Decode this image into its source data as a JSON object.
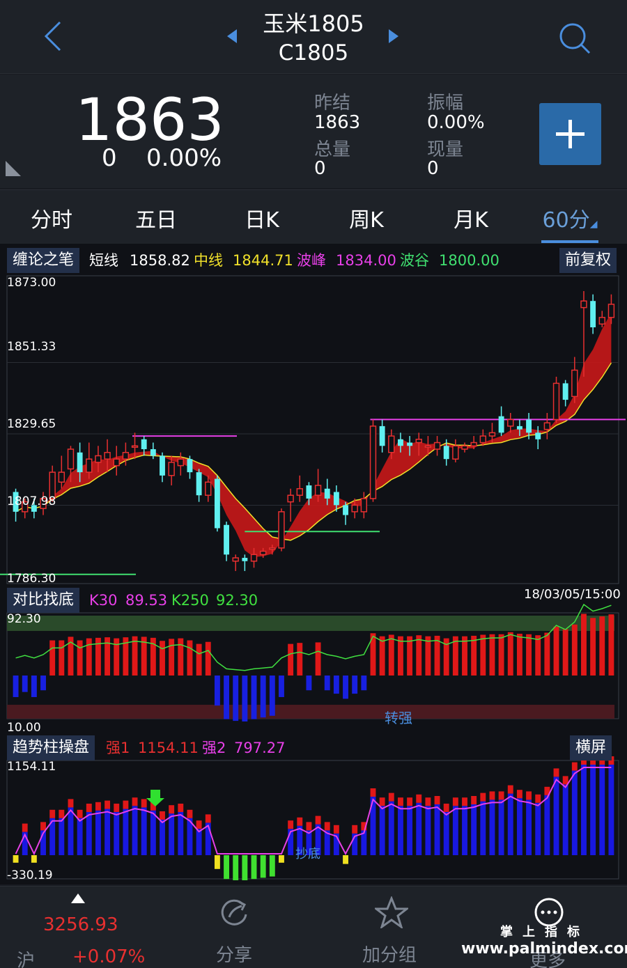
{
  "header": {
    "title": "玉米1805",
    "code": "C1805",
    "colors": {
      "accent": "#4a8ede"
    }
  },
  "quote": {
    "price": "1863",
    "change": "0",
    "change_pct": "0.00%",
    "stats": [
      {
        "label": "昨结",
        "value": "1863"
      },
      {
        "label": "振幅",
        "value": "0.00%"
      },
      {
        "label": "总量",
        "value": "0"
      },
      {
        "label": "现量",
        "value": "0"
      }
    ],
    "add_button": "+"
  },
  "tabs": {
    "items": [
      "分时",
      "五日",
      "日K",
      "周K",
      "月K",
      "60分"
    ],
    "active": "60分"
  },
  "main_chart": {
    "panel_label": "缠论之笔",
    "short_label": "短线",
    "short_value": "1858.82",
    "mid_label": "中线",
    "mid_value": "1844.71",
    "peak_label": "波峰",
    "peak_value": "1834.00",
    "trough_label": "波谷",
    "trough_value": "1800.00",
    "adjust_button": "前复权",
    "y_ticks": [
      "1873.00",
      "1851.33",
      "1829.65",
      "1807.98",
      "1786.30"
    ],
    "timestamp": "18/03/05/15:00"
  },
  "compare_panel": {
    "label": "对比找底",
    "k30_label": "K30",
    "k30_value": "89.53",
    "k250_label": "K250",
    "k250_value": "92.30",
    "y_top": "92.30",
    "y_bottom": "10.00",
    "signal": "转强"
  },
  "trend_panel": {
    "label": "趋势柱操盘",
    "s1_label": "强1",
    "s1_value": "1154.11",
    "s2_label": "强2",
    "s2_value": "797.27",
    "landscape_button": "横屏",
    "y_top": "1154.11",
    "y_bottom": "-330.19",
    "signal": "抄底"
  },
  "bottom_bar": {
    "index_value": "3256.93",
    "index_name": "沪",
    "index_change": "+0.07%",
    "share": "分享",
    "add_group": "加分组",
    "more": "更多"
  },
  "watermark": {
    "cn": "掌上指标",
    "url": "www.palmindex.com"
  },
  "chart_data": {
    "type": "candlestick",
    "y_range": [
      1786.3,
      1873.0
    ],
    "candles": [
      [
        1812,
        1806,
        1813,
        1803
      ],
      [
        1806,
        1809,
        1810,
        1804
      ],
      [
        1808,
        1806,
        1810,
        1804
      ],
      [
        1807,
        1810,
        1812,
        1805
      ],
      [
        1810,
        1818,
        1820,
        1809
      ],
      [
        1815,
        1818,
        1823,
        1813
      ],
      [
        1819,
        1825,
        1826,
        1815
      ],
      [
        1824,
        1818,
        1827,
        1815
      ],
      [
        1818,
        1822,
        1827,
        1816
      ],
      [
        1821,
        1823,
        1826,
        1818
      ],
      [
        1822,
        1824,
        1828,
        1818
      ],
      [
        1820,
        1822,
        1826,
        1817
      ],
      [
        1822,
        1824,
        1827,
        1820
      ],
      [
        1826,
        1826,
        1830,
        1822
      ],
      [
        1828,
        1825,
        1829,
        1823
      ],
      [
        1825,
        1823,
        1827,
        1822
      ],
      [
        1823,
        1817,
        1824,
        1815
      ],
      [
        1817,
        1821,
        1823,
        1814
      ],
      [
        1820,
        1822,
        1824,
        1817
      ],
      [
        1822,
        1818,
        1823,
        1816
      ],
      [
        1818,
        1811,
        1819,
        1809
      ],
      [
        1811,
        1815,
        1817,
        1809
      ],
      [
        1816,
        1801,
        1817,
        1800
      ],
      [
        1802,
        1793,
        1803,
        1791
      ],
      [
        1791,
        1792,
        1793,
        1788
      ],
      [
        1792,
        1791,
        1793,
        1788
      ],
      [
        1791,
        1793,
        1795,
        1789
      ],
      [
        1793,
        1794,
        1795,
        1792
      ],
      [
        1795,
        1795,
        1796,
        1793
      ],
      [
        1795,
        1806,
        1807,
        1794
      ],
      [
        1809,
        1811,
        1813,
        1803
      ],
      [
        1811,
        1813,
        1817,
        1809
      ],
      [
        1814,
        1810,
        1815,
        1808
      ],
      [
        1811,
        1814,
        1819,
        1809
      ],
      [
        1813,
        1810,
        1816,
        1808
      ],
      [
        1812,
        1808,
        1814,
        1806
      ],
      [
        1808,
        1805,
        1809,
        1802
      ],
      [
        1806,
        1808,
        1810,
        1804
      ],
      [
        1806,
        1810,
        1812,
        1804
      ],
      [
        1810,
        1832,
        1834,
        1809
      ],
      [
        1832,
        1826,
        1834,
        1824
      ],
      [
        1824,
        1829,
        1831,
        1822
      ],
      [
        1828,
        1826,
        1830,
        1824
      ],
      [
        1827,
        1826,
        1829,
        1823
      ],
      [
        1827,
        1828,
        1830,
        1823
      ],
      [
        1826,
        1826,
        1829,
        1823
      ],
      [
        1825,
        1827,
        1829,
        1823
      ],
      [
        1826,
        1822,
        1828,
        1820
      ],
      [
        1822,
        1826,
        1828,
        1821
      ],
      [
        1825,
        1826,
        1827,
        1824
      ],
      [
        1826,
        1827,
        1829,
        1825
      ],
      [
        1827,
        1829,
        1831,
        1826
      ],
      [
        1829,
        1830,
        1833,
        1827
      ],
      [
        1835,
        1830,
        1838,
        1829
      ],
      [
        1832,
        1834,
        1836,
        1830
      ],
      [
        1832,
        1831,
        1834,
        1829
      ],
      [
        1834,
        1830,
        1836,
        1828
      ],
      [
        1830,
        1828,
        1832,
        1825
      ],
      [
        1831,
        1833,
        1836,
        1828
      ],
      [
        1834,
        1845,
        1847,
        1833
      ],
      [
        1845,
        1840,
        1846,
        1838
      ],
      [
        1841,
        1849,
        1853,
        1839
      ],
      [
        1868,
        1870,
        1873,
        1847
      ],
      [
        1870,
        1862,
        1872,
        1860
      ],
      [
        1863,
        1865,
        1867,
        1862
      ],
      [
        1865,
        1869,
        1872,
        1863
      ]
    ],
    "peak_line": 1834.0,
    "trough_line": 1800.0
  }
}
